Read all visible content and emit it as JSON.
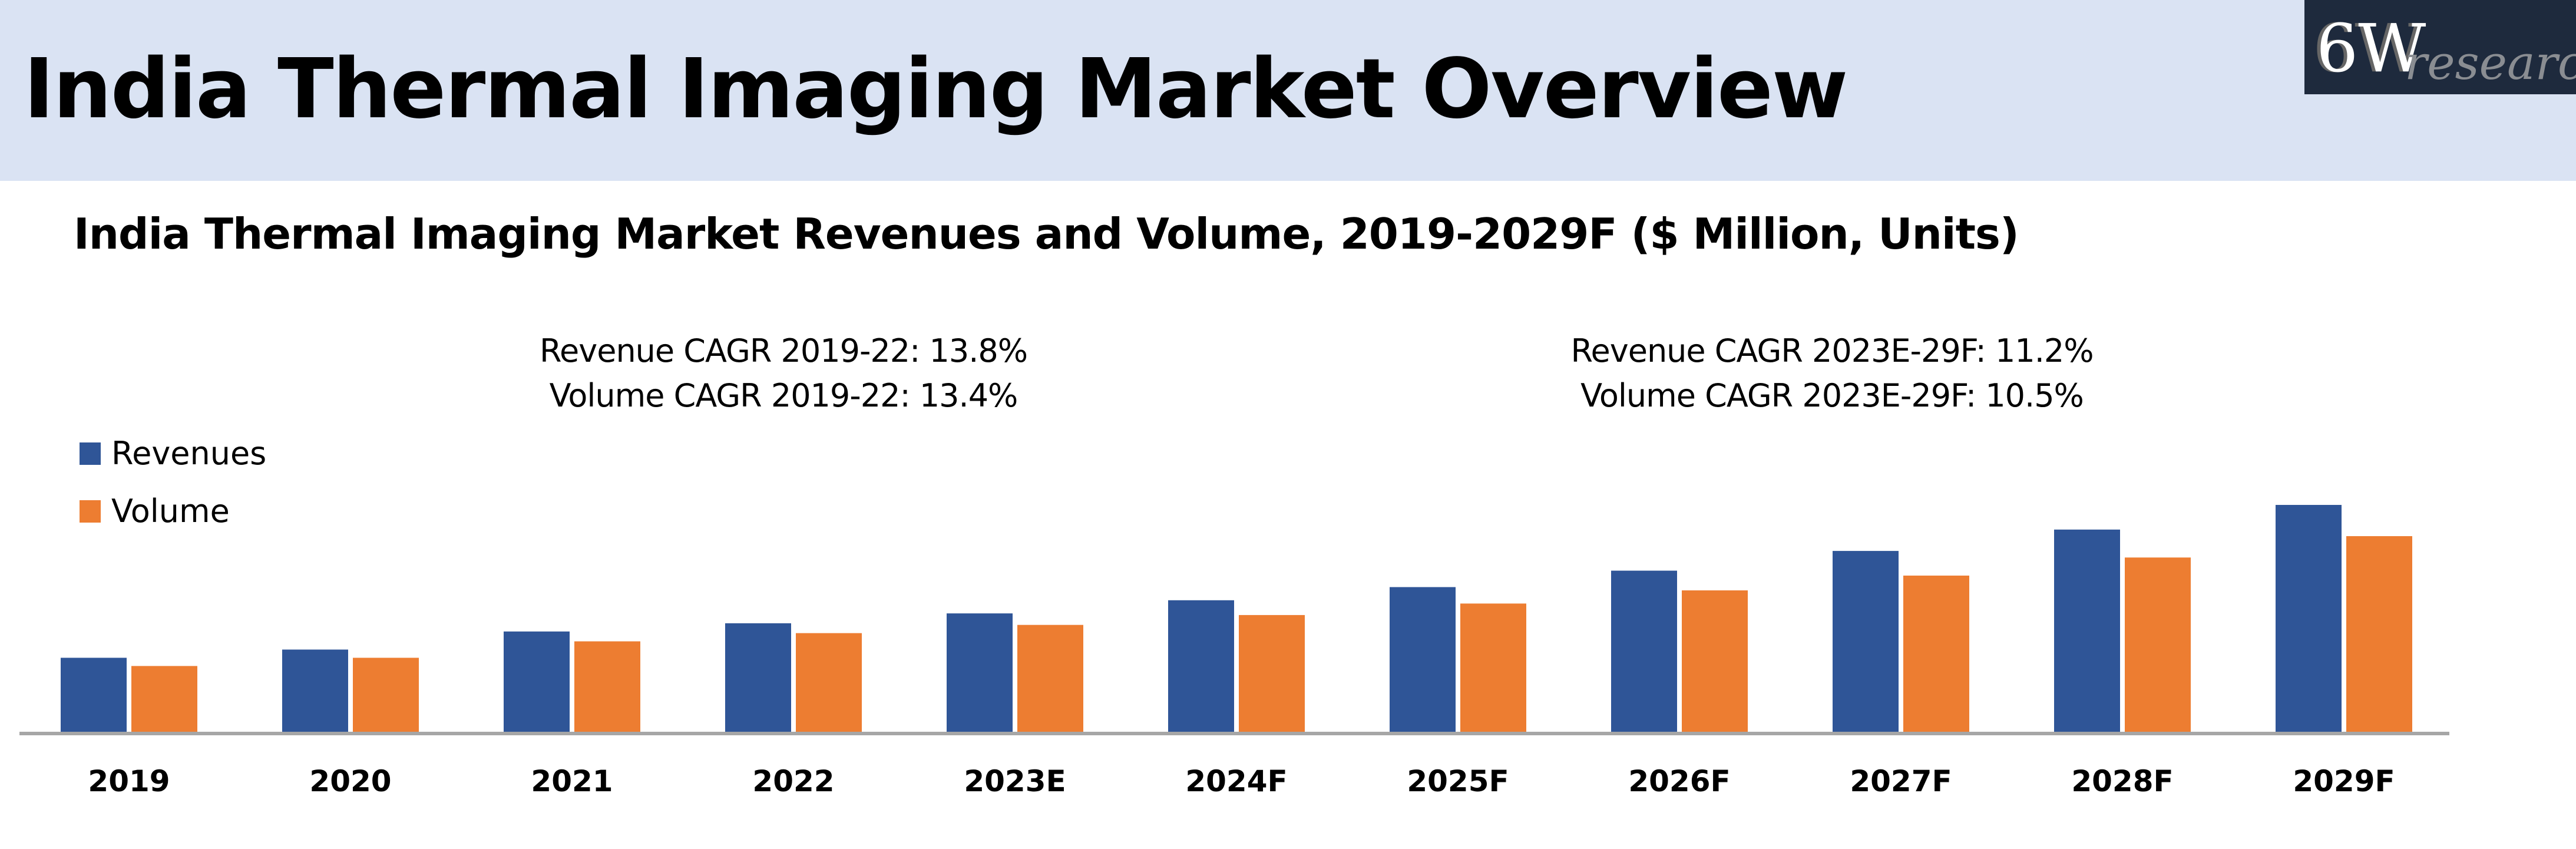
{
  "header": {
    "title": "India Thermal Imaging Market Overview",
    "logo_main": "6W",
    "logo_sub": "research"
  },
  "cagr": {
    "left": [
      "Revenue CAGR 2019-22: 13.8%",
      "Volume CAGR 2019-22: 13.4%"
    ],
    "right": [
      "Revenue CAGR 2023E-29F: 11.2%",
      "Volume CAGR 2023E-29F: 10.5%"
    ]
  },
  "chart_data": {
    "type": "bar",
    "title": "India Thermal Imaging Market Revenues and Volume, 2019-2029F ($ Million, Units)",
    "categories": [
      "2019",
      "2020",
      "2021",
      "2022",
      "2023E",
      "2024F",
      "2025F",
      "2026F",
      "2027F",
      "2028F",
      "2029F"
    ],
    "series": [
      {
        "name": "Revenues",
        "color": "#2f5597",
        "values": [
          45,
          50,
          61,
          66,
          72,
          80,
          88,
          98,
          110,
          123,
          138
        ]
      },
      {
        "name": "Volume",
        "color": "#ed7d31",
        "values": [
          40,
          45,
          55,
          60,
          65,
          71,
          78,
          86,
          95,
          106,
          119
        ]
      }
    ],
    "ylim": [
      0,
      140
    ],
    "note": "relative scale, no y-axis shown",
    "legend": "top-left",
    "grid": false
  }
}
